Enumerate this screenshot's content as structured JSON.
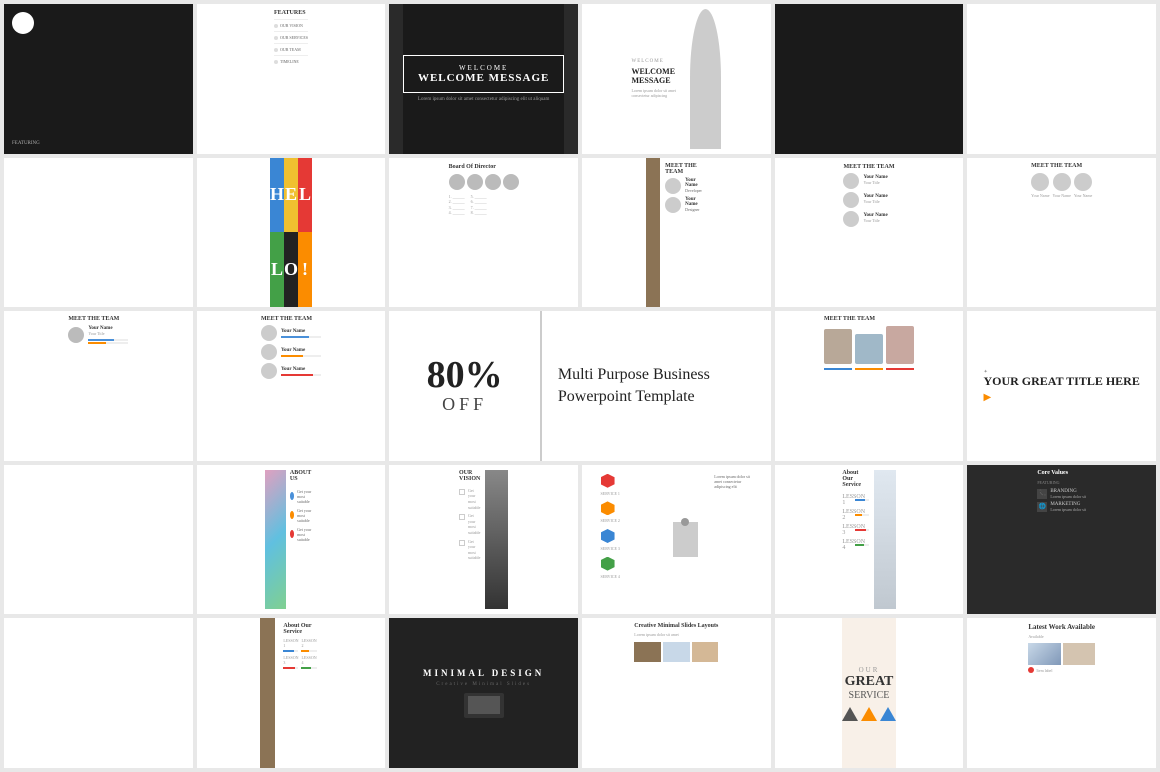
{
  "promo": {
    "percent": "80%",
    "off": "OFF",
    "title": "Multi Purpose Business Powerpoint Template"
  },
  "slides": {
    "welcome": "WELCOME MESSAGE",
    "meet_team": "MEET THE TEAM",
    "board": "Board Of Director",
    "hello": "HELLO!",
    "your_title": "YOUR GREAT TITLE HERE",
    "our_vision": "OUR VISION",
    "about_us": "ABOUT US",
    "about_service": "About Our Service",
    "core_values": "Core Values",
    "our_great": "OUR GREAT SERVICE",
    "minimal": "MINIMAL DESIGN",
    "creative": "Creative Minimal Slides Layouts",
    "latest": "Latest Work Available",
    "featuring": "FEATURING"
  },
  "colors": {
    "blue": "#3a86d4",
    "orange": "#fb8c00",
    "red": "#e53935",
    "green": "#43a047",
    "dark": "#1a1a1a",
    "light_bg": "#f0f0f0"
  }
}
